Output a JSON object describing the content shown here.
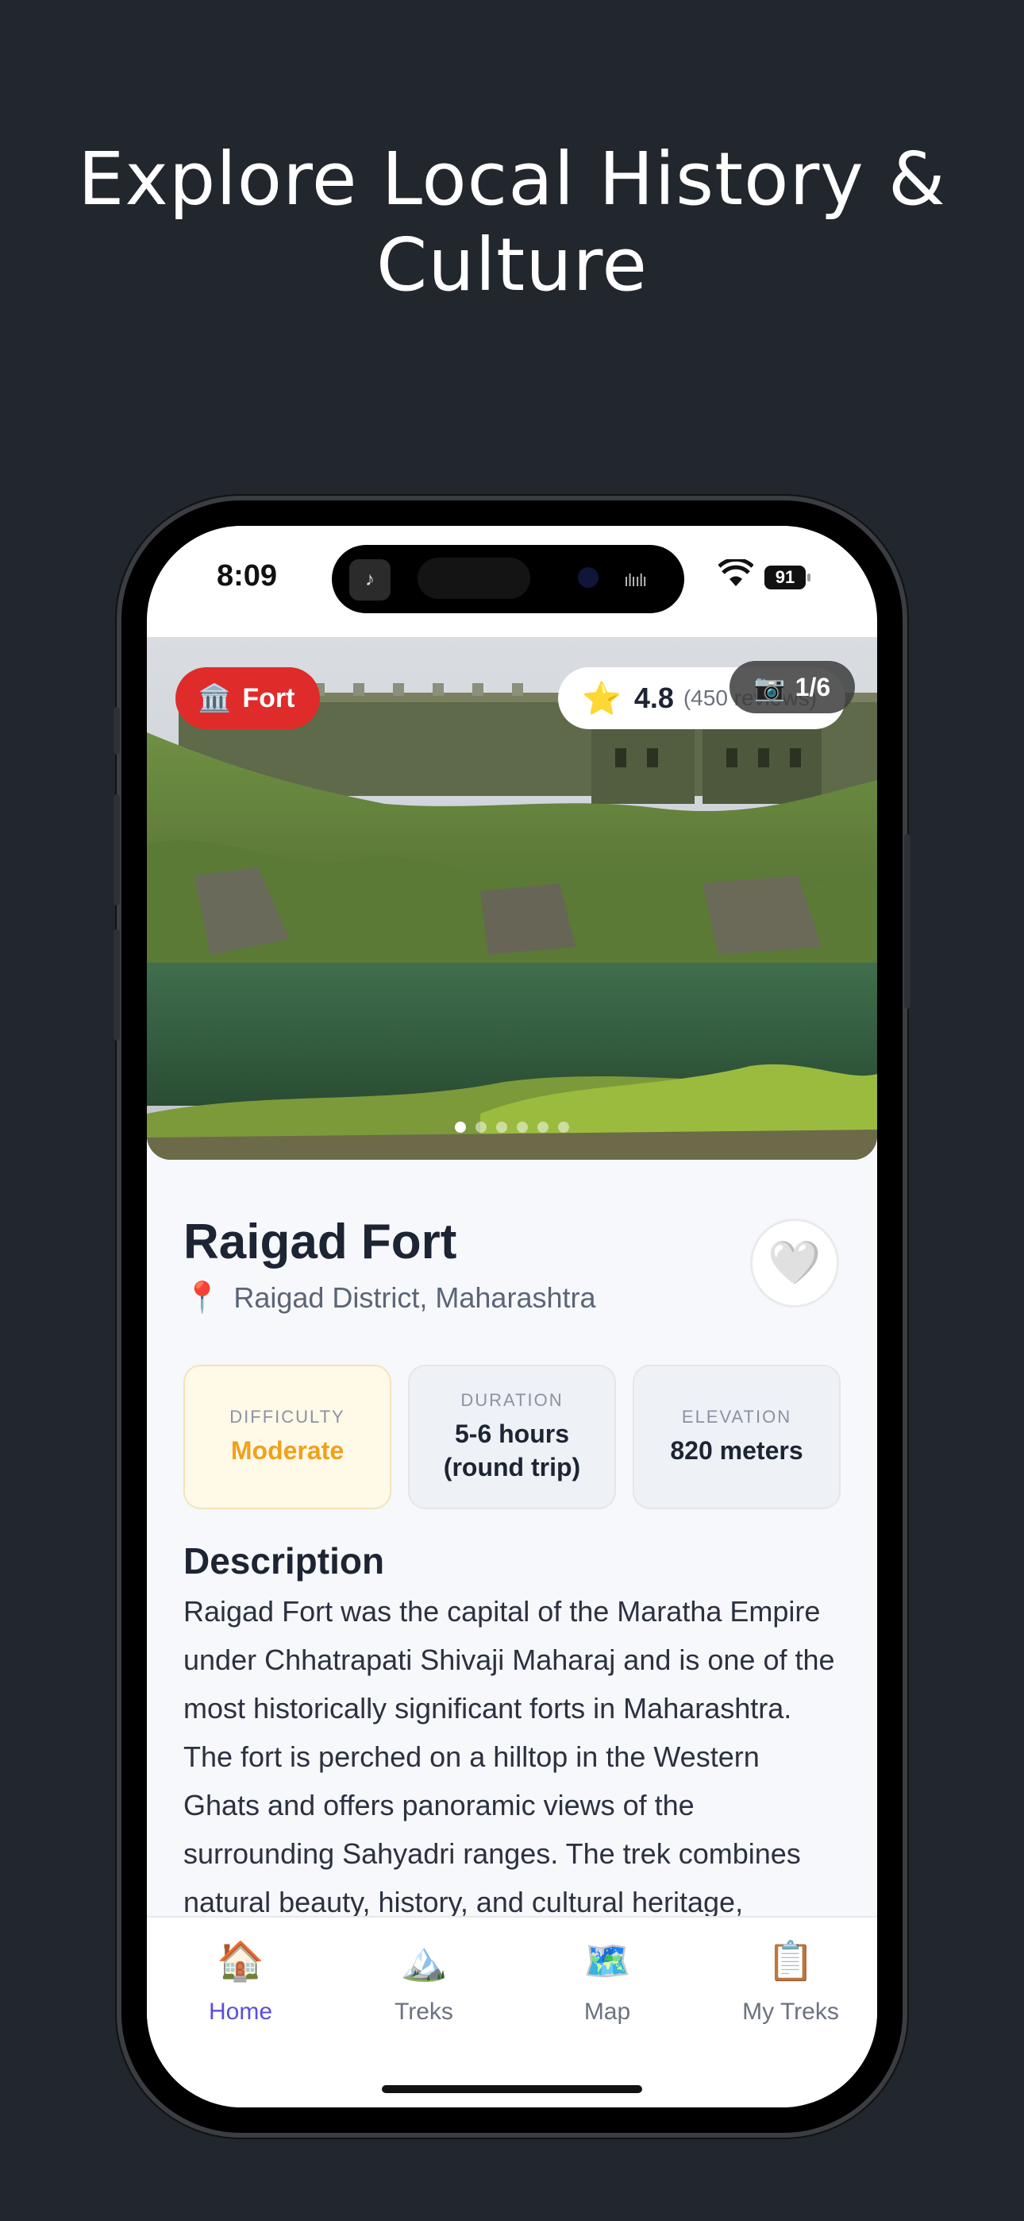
{
  "headline": "Explore Local History & Culture",
  "status_bar": {
    "time": "8:09",
    "battery": "91"
  },
  "hero": {
    "type_badge": {
      "icon": "🏛️",
      "label": "Fort"
    },
    "rating": {
      "star": "⭐",
      "value": "4.8",
      "reviews": "(450 reviews)"
    },
    "photo_counter": {
      "icon": "📷",
      "label": "1/6"
    },
    "dots_total": 6,
    "dots_active": 1
  },
  "place": {
    "title": "Raigad Fort",
    "location_icon": "📍",
    "location": "Raigad District, Maharashtra",
    "favorite_icon": "🤍"
  },
  "stats": [
    {
      "label": "DIFFICULTY",
      "value": "Moderate"
    },
    {
      "label": "DURATION",
      "value": "5-6 hours (round trip)"
    },
    {
      "label": "ELEVATION",
      "value": "820 meters"
    }
  ],
  "description": {
    "heading": "Description",
    "text": "Raigad Fort was the capital of the Maratha Empire under Chhatrapati Shivaji Maharaj and is one of the most historically significant forts in Maharashtra. The fort is perched on a hilltop in the Western Ghats and offers panoramic views of the surrounding Sahyadri ranges. The trek combines natural beauty, history, and cultural heritage, featuring the famous Maha"
  },
  "tabs": [
    {
      "icon": "🏠",
      "label": "Home",
      "active": true
    },
    {
      "icon": "🏔️",
      "label": "Treks",
      "active": false
    },
    {
      "icon": "🗺️",
      "label": "Map",
      "active": false
    },
    {
      "icon": "📋",
      "label": "My Treks",
      "active": false
    }
  ],
  "colors": {
    "background": "#22262d",
    "fort_badge": "#e02b2b",
    "difficulty": "#f0a11c",
    "tab_active": "#5b50d6"
  }
}
